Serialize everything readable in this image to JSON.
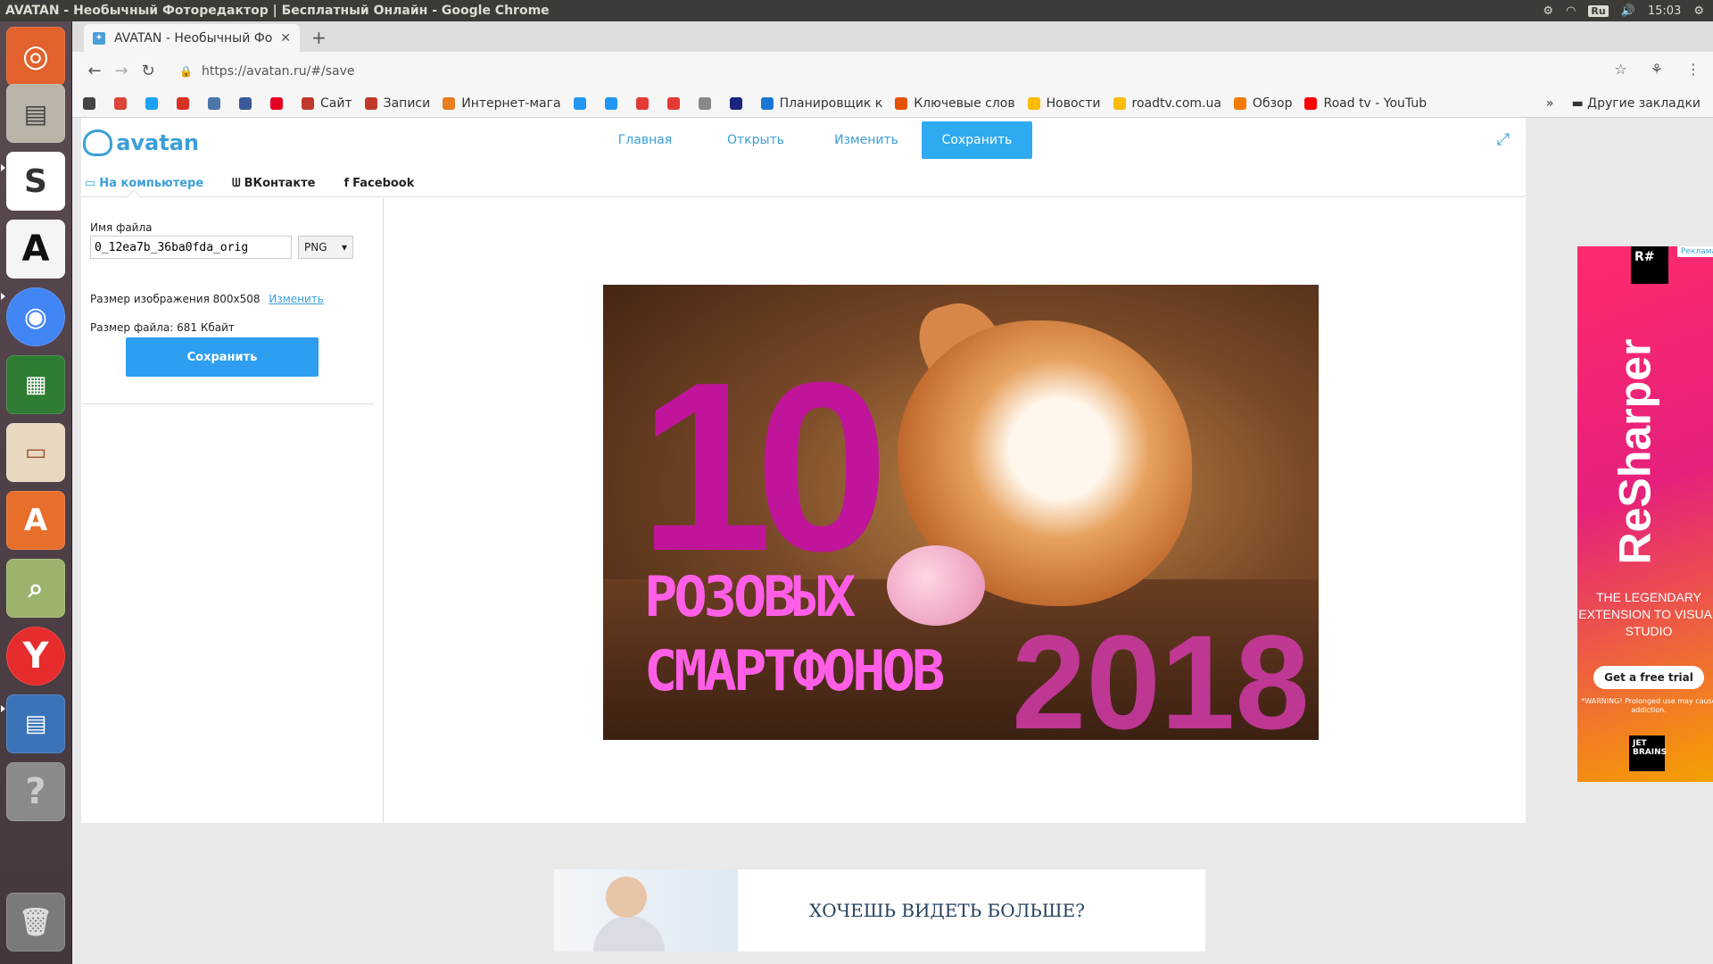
{
  "system": {
    "window_title": "AVATAN - Необычный Фоторедактор | Бесплатный Онлайн - Google Chrome",
    "keyboard_layout": "Ru",
    "clock": "15:03"
  },
  "browser": {
    "tab_title": "AVATAN - Необычный Фо",
    "url": "https://avatan.ru/#/save",
    "bookmarks": [
      {
        "label": "",
        "color": "#444"
      },
      {
        "label": "",
        "color": "#db4437"
      },
      {
        "label": "",
        "color": "#1da1f2"
      },
      {
        "label": "",
        "color": "#d93025"
      },
      {
        "label": "",
        "color": "#4a76a8"
      },
      {
        "label": "",
        "color": "#3b5998"
      },
      {
        "label": "",
        "color": "#e60023"
      },
      {
        "label": "Сайт",
        "color": "#c0392b"
      },
      {
        "label": "Записи",
        "color": "#c0392b"
      },
      {
        "label": "Интернет-мага",
        "color": "#e67e22"
      },
      {
        "label": "",
        "color": "#2196f3"
      },
      {
        "label": "",
        "color": "#2196f3"
      },
      {
        "label": "",
        "color": "#e53935"
      },
      {
        "label": "",
        "color": "#e53935"
      },
      {
        "label": "",
        "color": "#888"
      },
      {
        "label": "",
        "color": "#1a237e"
      },
      {
        "label": "Планировщик к",
        "color": "#1976d2"
      },
      {
        "label": "Ключевые слов",
        "color": "#e65100"
      },
      {
        "label": "Новости",
        "color": "#fbbc05"
      },
      {
        "label": "roadtv.com.ua",
        "color": "#fbbc05"
      },
      {
        "label": "Обзор",
        "color": "#f57c00"
      },
      {
        "label": "Road tv - YouTub",
        "color": "#ff0000"
      }
    ],
    "other_bookmarks": "Другие закладки"
  },
  "avatan": {
    "logo": "avatan",
    "nav": [
      "Главная",
      "Открыть",
      "Изменить",
      "Сохранить"
    ],
    "active_nav": "Сохранить",
    "subtabs": [
      "На компьютере",
      "ВКонтакте",
      "Facebook"
    ],
    "active_subtab": "На компьютере",
    "panel": {
      "filename_label": "Имя файла",
      "filename_value": "0_12ea7b_36ba0fda_orig",
      "format": "PNG",
      "image_size_label": "Размер изображения 800x508",
      "change_link": "Изменить",
      "file_size_label": "Размер файла: 681 Кбайт",
      "save_button": "Сохранить"
    },
    "preview": {
      "big_number": "10",
      "line1": "РОЗОВЫХ",
      "line2": "СМАРТФОНОВ",
      "year": "2018"
    }
  },
  "ad": {
    "badge": "R#",
    "tag": "Реклама",
    "product": "ReSharper",
    "tagline": "THE LEGENDARY EXTENSION TO VISUAL STUDIO",
    "cta": "Get a free trial",
    "warning": "*WARNING! Prolonged use may cause addiction.",
    "brand": "JET BRAINS"
  },
  "banner": {
    "text": "ХОЧЕШЬ ВИДЕТЬ БОЛЬШЕ?"
  }
}
